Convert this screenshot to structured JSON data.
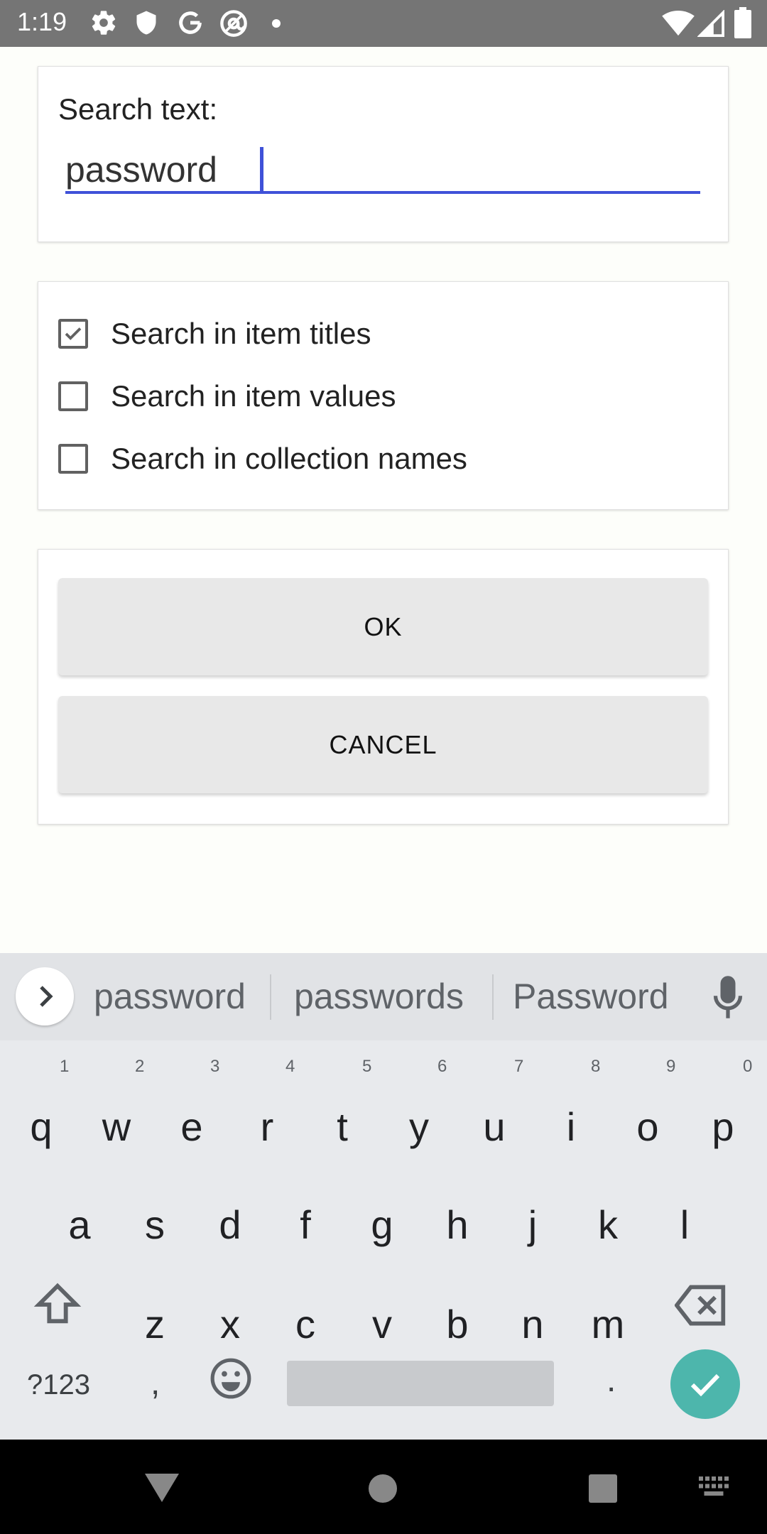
{
  "status_bar": {
    "time": "1:19",
    "left_icons": [
      "gear-icon",
      "shield-icon",
      "google-icon",
      "at-sign-icon",
      "dot-icon"
    ],
    "right_icons": [
      "wifi-icon",
      "cell-signal-icon",
      "battery-icon"
    ]
  },
  "search_card": {
    "label": "Search text:",
    "input_value": "password"
  },
  "options": [
    {
      "label": "Search in item titles",
      "checked": true
    },
    {
      "label": "Search in item values",
      "checked": false
    },
    {
      "label": "Search in collection names",
      "checked": false
    }
  ],
  "buttons": {
    "ok": "OK",
    "cancel": "CANCEL"
  },
  "keyboard": {
    "suggestions": [
      "password",
      "passwords",
      "Password"
    ],
    "row1": [
      "q",
      "w",
      "e",
      "r",
      "t",
      "y",
      "u",
      "i",
      "o",
      "p"
    ],
    "row1_numbers": [
      "1",
      "2",
      "3",
      "4",
      "5",
      "6",
      "7",
      "8",
      "9",
      "0"
    ],
    "row2": [
      "a",
      "s",
      "d",
      "f",
      "g",
      "h",
      "j",
      "k",
      "l"
    ],
    "row3": [
      "z",
      "x",
      "c",
      "v",
      "b",
      "n",
      "m"
    ],
    "symbols_key": "?123",
    "comma_key": ",",
    "period_key": ".",
    "accent_color": "#4db6ac"
  },
  "colors": {
    "input_underline": "#3f51d8",
    "status_bar_bg": "#757575"
  }
}
